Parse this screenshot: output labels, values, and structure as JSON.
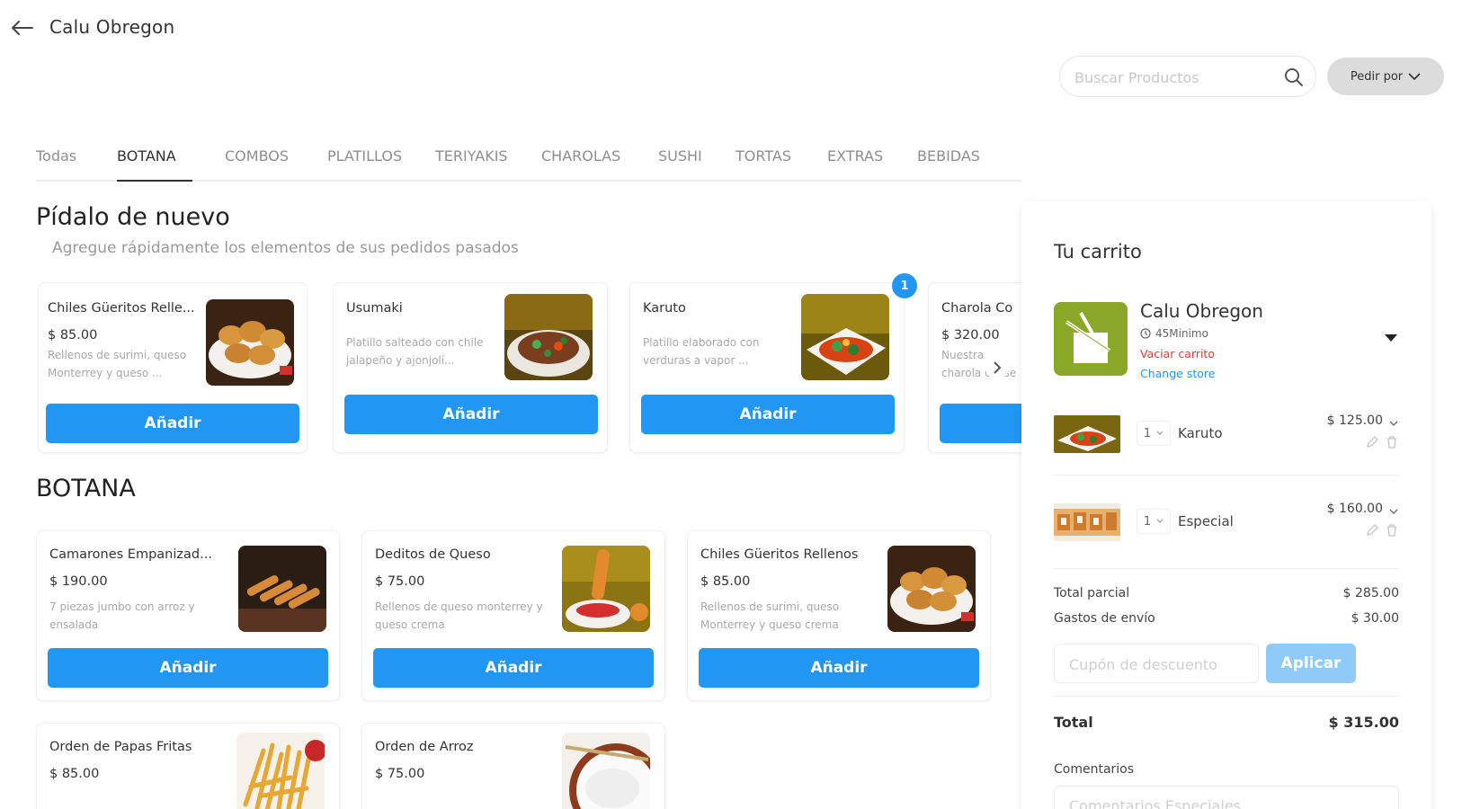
{
  "header": {
    "store_title": "Calu Obregon",
    "search_placeholder": "Buscar Productos",
    "order_by_label": "Pedir por"
  },
  "tabs": [
    "Todas",
    "BOTANA",
    "COMBOS",
    "PLATILLOS",
    "TERIYAKIS",
    "CHAROLAS",
    "SUSHI",
    "TORTAS",
    "EXTRAS",
    "BEBIDAS"
  ],
  "active_tab": "BOTANA",
  "reorder": {
    "title": "Pídalo de nuevo",
    "subtitle": "Agregue rápidamente los elementos de sus pedidos pasados",
    "badge": "1",
    "items": [
      {
        "name": "Chiles Güeritos Relle...",
        "price": "$ 85.00",
        "desc": "Rellenos de surimi, queso Monterrey y queso ...",
        "button": "Añadir"
      },
      {
        "name": "Usumaki",
        "price": "",
        "desc": "Platillo salteado con chile jalapeño y ajonjolí...",
        "button": "Añadir"
      },
      {
        "name": "Karuto",
        "price": "",
        "desc": "Platillo elaborado con verduras a vapor ...",
        "button": "Añadir"
      },
      {
        "name": "Charola Co",
        "price": "$ 320.00",
        "desc": "Nuestra charola conse",
        "button": ""
      }
    ]
  },
  "category": {
    "title": "BOTANA",
    "items": [
      {
        "name": "Camarones Empanizad...",
        "price": "$ 190.00",
        "desc": "7 piezas jumbo con arroz y ensalada",
        "button": "Añadir"
      },
      {
        "name": "Deditos de Queso",
        "price": "$ 75.00",
        "desc": "Rellenos de queso monterrey y queso crema",
        "button": "Añadir"
      },
      {
        "name": "Chiles Güeritos Rellenos",
        "price": "$ 85.00",
        "desc": "Rellenos de surimi, queso Monterrey y queso crema",
        "button": "Añadir"
      },
      {
        "name": "Orden de Papas Fritas",
        "price": "$ 85.00",
        "desc": "",
        "button": ""
      },
      {
        "name": "Orden de Arroz",
        "price": "$ 75.00",
        "desc": "",
        "button": ""
      }
    ]
  },
  "cart": {
    "title": "Tu carrito",
    "store_name": "Calu Obregon",
    "store_time": "45Minimo",
    "empty_cart": "Vaciar carrito",
    "change_store": "Change store",
    "lines": [
      {
        "qty": "1",
        "name": "Karuto",
        "price": "$ 125.00"
      },
      {
        "qty": "1",
        "name": "Especial",
        "price": "$ 160.00"
      }
    ],
    "subtotal_label": "Total parcial",
    "subtotal_value": "$ 285.00",
    "shipping_label": "Gastos de envío",
    "shipping_value": "$ 30.00",
    "coupon_placeholder": "Cupón de descuento",
    "apply_label": "Aplicar",
    "total_label": "Total",
    "total_value": "$ 315.00",
    "comments_label": "Comentarios",
    "comments_placeholder": "Comentarios Especiales"
  },
  "colors": {
    "primary": "#2196f3",
    "primary_disabled": "#90caf9",
    "danger": "#e53935",
    "store_logo_bg": "#8aa827"
  }
}
